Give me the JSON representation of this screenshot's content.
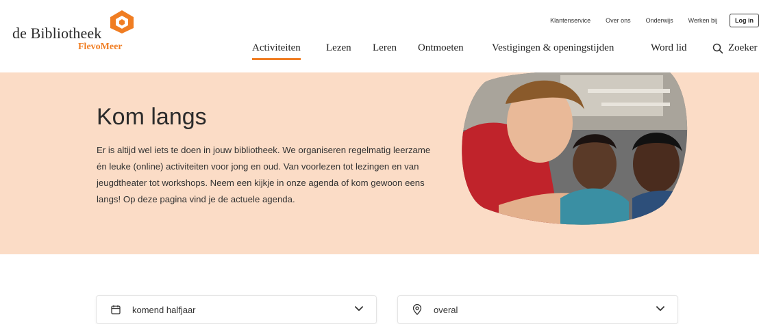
{
  "brand": {
    "name": "de Bibliotheek",
    "region": "FlevoMeer",
    "accent": "#f07d22",
    "hero_bg": "#fbdcc6"
  },
  "topnav": {
    "links": [
      "Klantenservice",
      "Over ons",
      "Onderwijs",
      "Werken bij"
    ],
    "login_label": "Log in"
  },
  "mainnav": {
    "items": [
      {
        "label": "Activiteiten",
        "active": true
      },
      {
        "label": "Lezen"
      },
      {
        "label": "Leren"
      },
      {
        "label": "Ontmoeten"
      },
      {
        "label": "Vestigingen & openingstijden"
      },
      {
        "label": "Word lid"
      }
    ],
    "search_label": "Zoeker",
    "search_icon": "search-icon"
  },
  "hero": {
    "title": "Kom langs",
    "body": "Er is altijd wel iets te doen in jouw bibliotheek. We organiseren regelmatig leerzame én leuke (online) activiteiten voor jong en oud. Van voorlezen tot lezingen en van jeugdtheater tot workshops. Neem een kijkje in onze agenda of kom gewoon eens langs! Op deze pagina vind je de actuele agenda."
  },
  "filters": {
    "period": {
      "value": "komend halfjaar",
      "icon": "calendar-icon"
    },
    "location": {
      "value": "overal",
      "icon": "location-pin-icon"
    }
  }
}
